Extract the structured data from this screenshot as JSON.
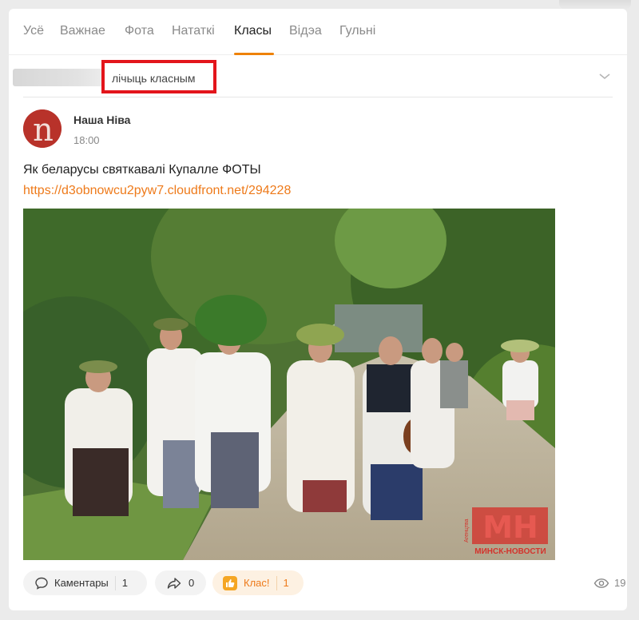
{
  "tabs": [
    {
      "label": "Усё"
    },
    {
      "label": "Важнае"
    },
    {
      "label": "Фота"
    },
    {
      "label": "Нататкі"
    },
    {
      "label": "Класы"
    },
    {
      "label": "Відэа"
    },
    {
      "label": "Гульні"
    }
  ],
  "active_tab": "Класы",
  "likes_line": {
    "text": "лічыць класным"
  },
  "post": {
    "author": "Наша Ніва",
    "avatar_letter": "n",
    "time": "18:00",
    "text": "Як беларусы святкавалі Купалле ФОТЫ",
    "link": "https://d3obnowcu2pyw7.cloudfront.net/294228",
    "image_watermark": {
      "small": "Агенцтва",
      "logo": "МН",
      "caption": "МИНСК-НОВОСТИ"
    }
  },
  "actions": {
    "comments_label": "Каментары",
    "comments_count": "1",
    "shares_count": "0",
    "like_label": "Клас!",
    "like_count": "1",
    "views_count": "19"
  },
  "colors": {
    "accent": "#ee8208",
    "highlight_box": "#e3151b",
    "avatar": "#b8322a"
  }
}
